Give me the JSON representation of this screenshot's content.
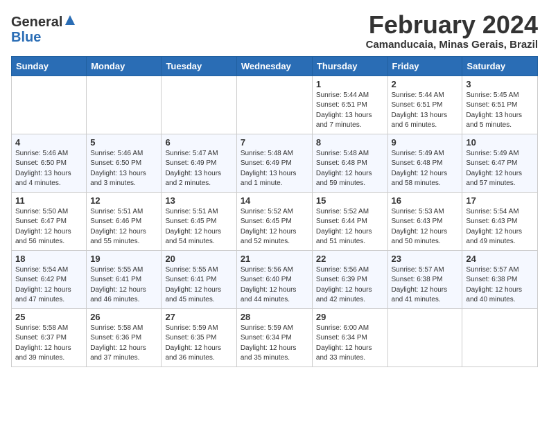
{
  "header": {
    "logo_line1": "General",
    "logo_line2": "Blue",
    "month_title": "February 2024",
    "subtitle": "Camanducaia, Minas Gerais, Brazil"
  },
  "weekdays": [
    "Sunday",
    "Monday",
    "Tuesday",
    "Wednesday",
    "Thursday",
    "Friday",
    "Saturday"
  ],
  "weeks": [
    [
      {
        "day": "",
        "info": ""
      },
      {
        "day": "",
        "info": ""
      },
      {
        "day": "",
        "info": ""
      },
      {
        "day": "",
        "info": ""
      },
      {
        "day": "1",
        "info": "Sunrise: 5:44 AM\nSunset: 6:51 PM\nDaylight: 13 hours\nand 7 minutes."
      },
      {
        "day": "2",
        "info": "Sunrise: 5:44 AM\nSunset: 6:51 PM\nDaylight: 13 hours\nand 6 minutes."
      },
      {
        "day": "3",
        "info": "Sunrise: 5:45 AM\nSunset: 6:51 PM\nDaylight: 13 hours\nand 5 minutes."
      }
    ],
    [
      {
        "day": "4",
        "info": "Sunrise: 5:46 AM\nSunset: 6:50 PM\nDaylight: 13 hours\nand 4 minutes."
      },
      {
        "day": "5",
        "info": "Sunrise: 5:46 AM\nSunset: 6:50 PM\nDaylight: 13 hours\nand 3 minutes."
      },
      {
        "day": "6",
        "info": "Sunrise: 5:47 AM\nSunset: 6:49 PM\nDaylight: 13 hours\nand 2 minutes."
      },
      {
        "day": "7",
        "info": "Sunrise: 5:48 AM\nSunset: 6:49 PM\nDaylight: 13 hours\nand 1 minute."
      },
      {
        "day": "8",
        "info": "Sunrise: 5:48 AM\nSunset: 6:48 PM\nDaylight: 12 hours\nand 59 minutes."
      },
      {
        "day": "9",
        "info": "Sunrise: 5:49 AM\nSunset: 6:48 PM\nDaylight: 12 hours\nand 58 minutes."
      },
      {
        "day": "10",
        "info": "Sunrise: 5:49 AM\nSunset: 6:47 PM\nDaylight: 12 hours\nand 57 minutes."
      }
    ],
    [
      {
        "day": "11",
        "info": "Sunrise: 5:50 AM\nSunset: 6:47 PM\nDaylight: 12 hours\nand 56 minutes."
      },
      {
        "day": "12",
        "info": "Sunrise: 5:51 AM\nSunset: 6:46 PM\nDaylight: 12 hours\nand 55 minutes."
      },
      {
        "day": "13",
        "info": "Sunrise: 5:51 AM\nSunset: 6:45 PM\nDaylight: 12 hours\nand 54 minutes."
      },
      {
        "day": "14",
        "info": "Sunrise: 5:52 AM\nSunset: 6:45 PM\nDaylight: 12 hours\nand 52 minutes."
      },
      {
        "day": "15",
        "info": "Sunrise: 5:52 AM\nSunset: 6:44 PM\nDaylight: 12 hours\nand 51 minutes."
      },
      {
        "day": "16",
        "info": "Sunrise: 5:53 AM\nSunset: 6:43 PM\nDaylight: 12 hours\nand 50 minutes."
      },
      {
        "day": "17",
        "info": "Sunrise: 5:54 AM\nSunset: 6:43 PM\nDaylight: 12 hours\nand 49 minutes."
      }
    ],
    [
      {
        "day": "18",
        "info": "Sunrise: 5:54 AM\nSunset: 6:42 PM\nDaylight: 12 hours\nand 47 minutes."
      },
      {
        "day": "19",
        "info": "Sunrise: 5:55 AM\nSunset: 6:41 PM\nDaylight: 12 hours\nand 46 minutes."
      },
      {
        "day": "20",
        "info": "Sunrise: 5:55 AM\nSunset: 6:41 PM\nDaylight: 12 hours\nand 45 minutes."
      },
      {
        "day": "21",
        "info": "Sunrise: 5:56 AM\nSunset: 6:40 PM\nDaylight: 12 hours\nand 44 minutes."
      },
      {
        "day": "22",
        "info": "Sunrise: 5:56 AM\nSunset: 6:39 PM\nDaylight: 12 hours\nand 42 minutes."
      },
      {
        "day": "23",
        "info": "Sunrise: 5:57 AM\nSunset: 6:38 PM\nDaylight: 12 hours\nand 41 minutes."
      },
      {
        "day": "24",
        "info": "Sunrise: 5:57 AM\nSunset: 6:38 PM\nDaylight: 12 hours\nand 40 minutes."
      }
    ],
    [
      {
        "day": "25",
        "info": "Sunrise: 5:58 AM\nSunset: 6:37 PM\nDaylight: 12 hours\nand 39 minutes."
      },
      {
        "day": "26",
        "info": "Sunrise: 5:58 AM\nSunset: 6:36 PM\nDaylight: 12 hours\nand 37 minutes."
      },
      {
        "day": "27",
        "info": "Sunrise: 5:59 AM\nSunset: 6:35 PM\nDaylight: 12 hours\nand 36 minutes."
      },
      {
        "day": "28",
        "info": "Sunrise: 5:59 AM\nSunset: 6:34 PM\nDaylight: 12 hours\nand 35 minutes."
      },
      {
        "day": "29",
        "info": "Sunrise: 6:00 AM\nSunset: 6:34 PM\nDaylight: 12 hours\nand 33 minutes."
      },
      {
        "day": "",
        "info": ""
      },
      {
        "day": "",
        "info": ""
      }
    ]
  ]
}
